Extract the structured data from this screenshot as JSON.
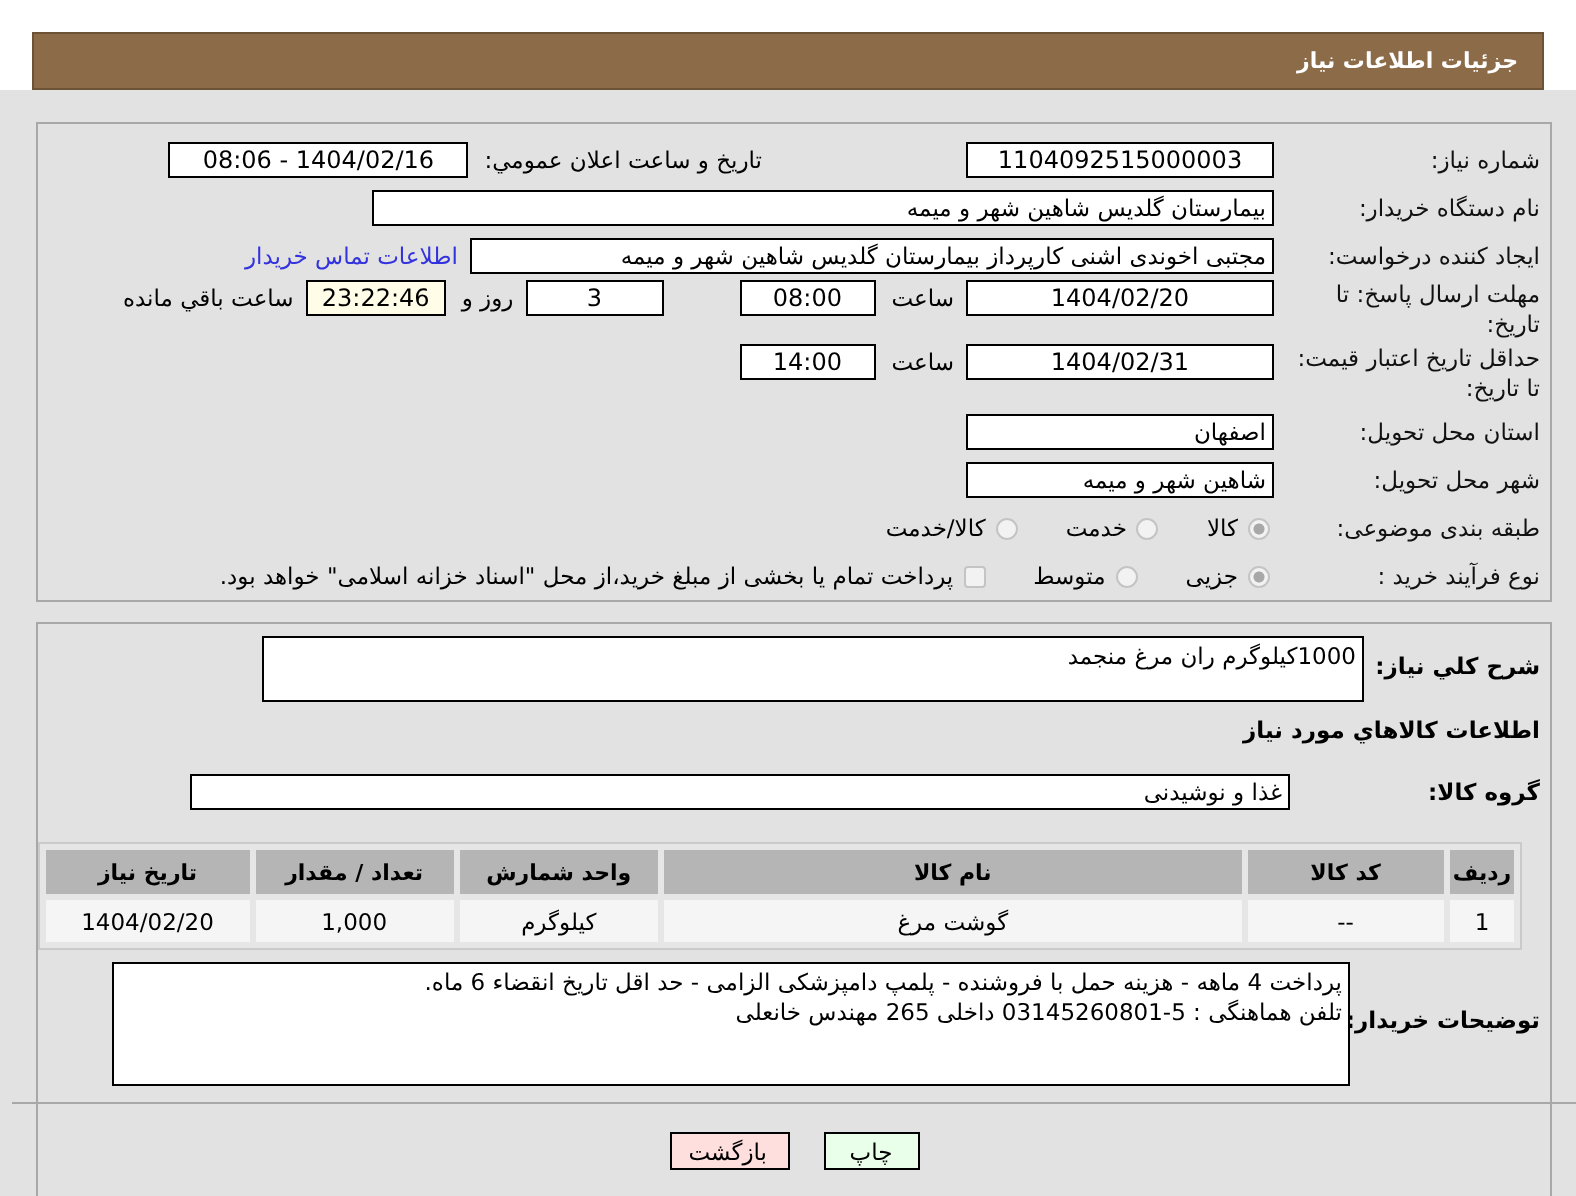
{
  "header": {
    "title": "جزئیات اطلاعات نیاز"
  },
  "need_number": {
    "label": "شماره نیاز:",
    "value": "1104092515000003"
  },
  "announce": {
    "label": "تاریخ و ساعت اعلان عمومي:",
    "value": "1404/02/16 - 08:06"
  },
  "buyer_org": {
    "label": "نام دستگاه خریدار:",
    "value": "بیمارستان گلدیس  شاهین شهر و میمه"
  },
  "requester": {
    "label": "ایجاد کننده درخواست:",
    "value": "مجتبی اخوندی اشنی کارپرداز بیمارستان گلدیس  شاهین شهر و میمه",
    "link": "اطلاعات تماس خریدار"
  },
  "deadline": {
    "label": "مهلت ارسال پاسخ: تا تاریخ:",
    "date": "1404/02/20",
    "time_label": "ساعت",
    "time": "08:00",
    "days": "3",
    "days_label": "روز و",
    "remaining": "23:22:46",
    "remaining_label": "ساعت باقي مانده"
  },
  "price_validity": {
    "label": "حداقل تاریخ اعتبار قیمت: تا تاریخ:",
    "date": "1404/02/31",
    "time_label": "ساعت",
    "time": "14:00"
  },
  "province": {
    "label": "استان محل تحویل:",
    "value": "اصفهان"
  },
  "city": {
    "label": "شهر محل تحویل:",
    "value": "شاهین شهر و میمه"
  },
  "category": {
    "label": "طبقه بندی موضوعی:",
    "options": [
      {
        "label": "کالا",
        "selected": true
      },
      {
        "label": "خدمت",
        "selected": false
      },
      {
        "label": "کالا/خدمت",
        "selected": false
      }
    ]
  },
  "process": {
    "label": "نوع فرآیند خرید :",
    "options": [
      {
        "label": "جزیی",
        "selected": true
      },
      {
        "label": "متوسط",
        "selected": false
      }
    ],
    "treasury": {
      "label": "پرداخت تمام یا بخشی از مبلغ خرید،از محل \"اسناد خزانه اسلامی\" خواهد بود.",
      "checked": false
    }
  },
  "description": {
    "label": "شرح کلي نیاز:",
    "value": "1000کیلوگرم ران مرغ منجمد"
  },
  "goods_heading": "اطلاعات کالاهاي مورد نیاز",
  "goods_group": {
    "label": "گروه کالا:",
    "value": "غذا و نوشیدنی"
  },
  "table": {
    "columns": [
      "ردیف",
      "کد کالا",
      "نام کالا",
      "واحد شمارش",
      "تعداد / مقدار",
      "تاریخ نیاز"
    ],
    "rows": [
      [
        "1",
        "--",
        "گوشت مرغ",
        "کیلوگرم",
        "1,000",
        "1404/02/20"
      ]
    ]
  },
  "buyer_notes": {
    "label": "توضیحات خریدار:",
    "lines": [
      "پرداخت 4 ماهه - هزینه حمل با فروشنده - پلمپ دامپزشکی الزامی - حد اقل تاریخ انقضاء 6 ماه.",
      "تلفن هماهنگی : 5-03145260801 داخلی 265 مهندس خانعلی"
    ]
  },
  "buttons": [
    {
      "label": "چاپ",
      "kind": "print"
    },
    {
      "label": "بازگشت",
      "kind": "back"
    }
  ]
}
